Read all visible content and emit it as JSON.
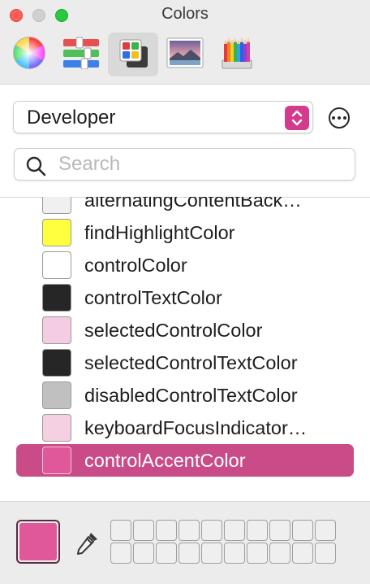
{
  "window": {
    "title": "Colors"
  },
  "toolbar": {
    "tools": [
      {
        "name": "color-wheel"
      },
      {
        "name": "color-sliders"
      },
      {
        "name": "color-palettes",
        "active": true
      },
      {
        "name": "image-palettes"
      },
      {
        "name": "pencils"
      }
    ]
  },
  "palette_popup": {
    "selected": "Developer",
    "stepper_color": "#d33c8c"
  },
  "search": {
    "placeholder": "Search",
    "value": ""
  },
  "color_list": {
    "items": [
      {
        "label": "alternatingContentBack…",
        "swatch": "#f0f0f0"
      },
      {
        "label": "findHighlightColor",
        "swatch": "#ffff40"
      },
      {
        "label": "controlColor",
        "swatch": "#ffffff"
      },
      {
        "label": "controlTextColor",
        "swatch": "#262626"
      },
      {
        "label": "selectedControlColor",
        "swatch": "#f5cde2"
      },
      {
        "label": "selectedControlTextColor",
        "swatch": "#262626"
      },
      {
        "label": "disabledControlTextColor",
        "swatch": "#c0c0c0"
      },
      {
        "label": "keyboardFocusIndicator…",
        "swatch": "#f5d0e3"
      },
      {
        "label": "controlAccentColor",
        "swatch": "#e0579a",
        "selected": true
      }
    ]
  },
  "current_color": "#e0579a",
  "accent_color": "#c94b88"
}
